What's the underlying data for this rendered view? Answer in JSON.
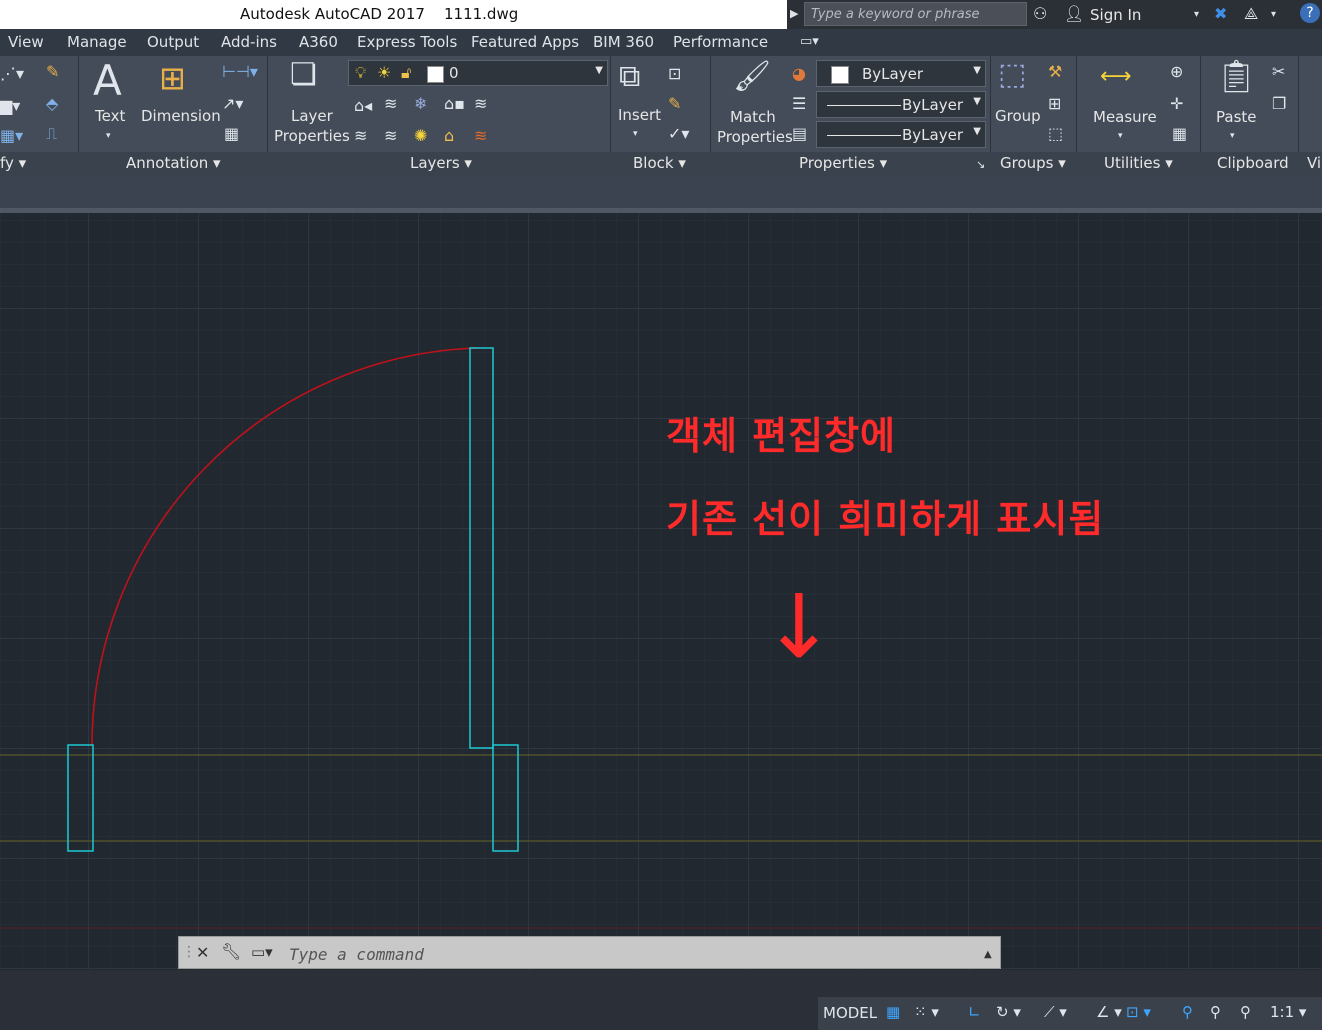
{
  "titlebar": {
    "app_title": "Autodesk AutoCAD 2017",
    "file_name": "1111.dwg",
    "search_placeholder": "Type a keyword or phrase",
    "sign_in": "Sign In"
  },
  "menu_tabs": [
    "View",
    "Manage",
    "Output",
    "Add-ins",
    "A360",
    "Express Tools",
    "Featured Apps",
    "BIM 360",
    "Performance"
  ],
  "ribbon": {
    "panels": {
      "modify": "fy",
      "annotation": "Annotation",
      "layers": "Layers",
      "block": "Block",
      "properties": "Properties",
      "groups": "Groups",
      "utilities": "Utilities",
      "clipboard": "Clipboard",
      "view": "Vi"
    },
    "buttons": {
      "text": "Text",
      "dimension": "Dimension",
      "layer_properties_1": "Layer",
      "layer_properties_2": "Properties",
      "insert": "Insert",
      "match_properties_1": "Match",
      "match_properties_2": "Properties",
      "group": "Group",
      "measure": "Measure",
      "paste": "Paste"
    },
    "layer_combo_value": "0",
    "color_combo_value": "ByLayer",
    "linetype_combo_value": "ByLayer",
    "lineweight_combo_value": "ByLayer"
  },
  "annotation_text": {
    "line1": "객체 편집창에",
    "line2": "기존 선이 희미하게 표시됨",
    "arrow": "↓",
    "color": "#ff2a2a"
  },
  "drawing_colors": {
    "arc": "#c0111a",
    "rectangles": "#1ec8d2",
    "reference_lines": "#5a5a2a"
  },
  "commandline": {
    "placeholder": "Type a command"
  },
  "statusbar": {
    "model": "MODEL",
    "scale": "1:1"
  }
}
